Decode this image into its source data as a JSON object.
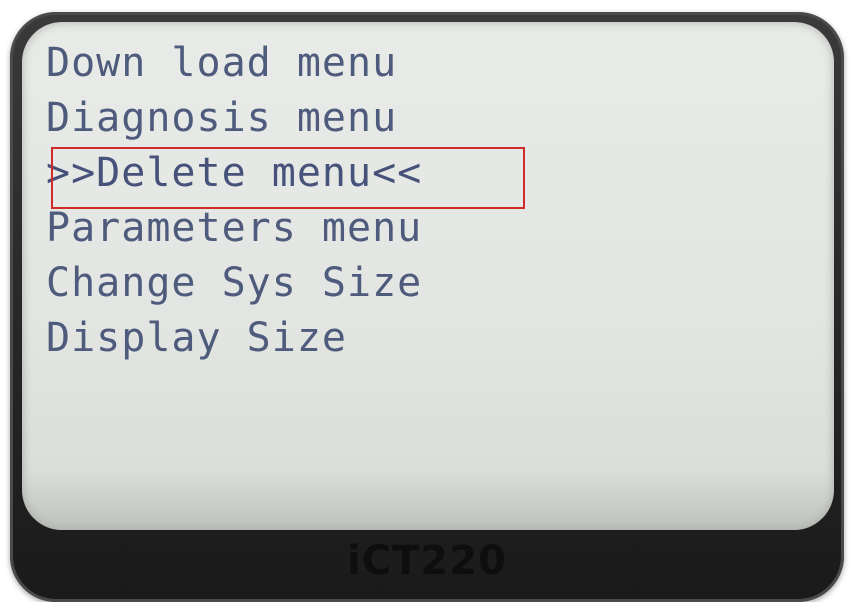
{
  "menu": {
    "items": [
      {
        "label": "Down load menu",
        "selected": false
      },
      {
        "label": "Diagnosis menu",
        "selected": false
      },
      {
        "label": ">>Delete menu<<",
        "selected": true
      },
      {
        "label": "Parameters menu",
        "selected": false
      },
      {
        "label": "Change Sys Size",
        "selected": false
      },
      {
        "label": "Display Size",
        "selected": false
      }
    ]
  },
  "device": {
    "model": "iCT220"
  },
  "colors": {
    "lcd_background": "#e6e8e5",
    "lcd_text": "#4f5b7c",
    "selection_highlight": "#d12a2a",
    "bezel": "#262626"
  }
}
